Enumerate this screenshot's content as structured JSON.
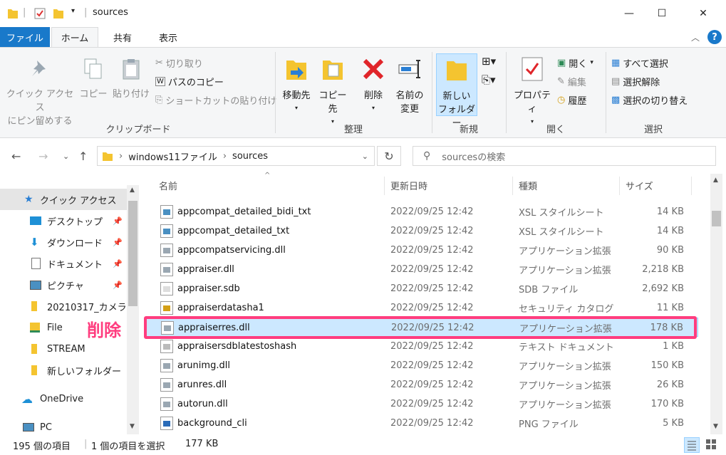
{
  "window": {
    "title": "sources"
  },
  "tabs": {
    "file": "ファイル",
    "home": "ホーム",
    "share": "共有",
    "view": "表示"
  },
  "ribbon": {
    "clipboard": {
      "label": "クリップボード",
      "pin_line1": "クイック アクセス",
      "pin_line2": "にピン留めする",
      "copy": "コピー",
      "paste": "貼り付け",
      "cut": "切り取り",
      "copy_path": "パスのコピー",
      "paste_shortcut": "ショートカットの貼り付け"
    },
    "organize": {
      "label": "整理",
      "move_to": "移動先",
      "copy_to": "コピー先",
      "delete": "削除",
      "rename_line1": "名前の",
      "rename_line2": "変更"
    },
    "new": {
      "label": "新規",
      "new_folder_line1": "新しい",
      "new_folder_line2": "フォルダー"
    },
    "open": {
      "label": "開く",
      "properties": "プロパティ",
      "open": "開く",
      "edit": "編集",
      "history": "履歴"
    },
    "select": {
      "label": "選択",
      "select_all": "すべて選択",
      "select_none": "選択解除",
      "invert": "選択の切り替え"
    }
  },
  "address": {
    "segments": [
      "windows11ファイル",
      "sources"
    ],
    "search_placeholder": "sourcesの検索"
  },
  "sidebar": {
    "items": [
      {
        "label": "クイック アクセス",
        "icon": "star-icon"
      },
      {
        "label": "デスクトップ",
        "icon": "desktop-icon"
      },
      {
        "label": "ダウンロード",
        "icon": "download-icon"
      },
      {
        "label": "ドキュメント",
        "icon": "document-icon"
      },
      {
        "label": "ピクチャ",
        "icon": "picture-icon"
      },
      {
        "label": "20210317_カメラ",
        "icon": "folder-icon"
      },
      {
        "label": "File",
        "icon": "folder-icon"
      },
      {
        "label": "STREAM",
        "icon": "folder-icon"
      },
      {
        "label": "新しいフォルダー",
        "icon": "folder-icon"
      },
      {
        "label": "OneDrive",
        "icon": "cloud-icon"
      },
      {
        "label": "PC",
        "icon": "pc-icon"
      }
    ]
  },
  "columns": {
    "name": "名前",
    "date": "更新日時",
    "type": "種類",
    "size": "サイズ"
  },
  "files": [
    {
      "name": "appcompat_detailed_bidi_txt",
      "date": "2022/09/25 12:42",
      "type": "XSL スタイルシート",
      "size": "14 KB",
      "icon": "xsl-icon"
    },
    {
      "name": "appcompat_detailed_txt",
      "date": "2022/09/25 12:42",
      "type": "XSL スタイルシート",
      "size": "14 KB",
      "icon": "xsl-icon"
    },
    {
      "name": "appcompatservicing.dll",
      "date": "2022/09/25 12:42",
      "type": "アプリケーション拡張",
      "size": "90 KB",
      "icon": "dll-icon"
    },
    {
      "name": "appraiser.dll",
      "date": "2022/09/25 12:42",
      "type": "アプリケーション拡張",
      "size": "2,218 KB",
      "icon": "dll-icon"
    },
    {
      "name": "appraiser.sdb",
      "date": "2022/09/25 12:42",
      "type": "SDB ファイル",
      "size": "2,692 KB",
      "icon": "file-icon"
    },
    {
      "name": "appraiserdatasha1",
      "date": "2022/09/25 12:42",
      "type": "セキュリティ カタログ",
      "size": "11 KB",
      "icon": "catalog-icon"
    },
    {
      "name": "appraiserres.dll",
      "date": "2022/09/25 12:42",
      "type": "アプリケーション拡張",
      "size": "178 KB",
      "icon": "dll-icon",
      "selected": true
    },
    {
      "name": "appraisersdblatestoshash",
      "date": "2022/09/25 12:42",
      "type": "テキスト ドキュメント",
      "size": "1 KB",
      "icon": "text-icon"
    },
    {
      "name": "arunimg.dll",
      "date": "2022/09/25 12:42",
      "type": "アプリケーション拡張",
      "size": "150 KB",
      "icon": "dll-icon"
    },
    {
      "name": "arunres.dll",
      "date": "2022/09/25 12:42",
      "type": "アプリケーション拡張",
      "size": "26 KB",
      "icon": "dll-icon"
    },
    {
      "name": "autorun.dll",
      "date": "2022/09/25 12:42",
      "type": "アプリケーション拡張",
      "size": "170 KB",
      "icon": "dll-icon"
    },
    {
      "name": "background_cli",
      "date": "2022/09/25 12:42",
      "type": "PNG ファイル",
      "size": "5 KB",
      "icon": "png-icon"
    }
  ],
  "annotation": {
    "text": "削除",
    "color": "#ff3d7f"
  },
  "status": {
    "count": "195 個の項目",
    "selection": "1 個の項目を選択",
    "selection_size": "177 KB"
  },
  "colors": {
    "accent": "#1979ca",
    "selection_bg": "#cce8ff",
    "highlight": "#ff3d7f"
  }
}
